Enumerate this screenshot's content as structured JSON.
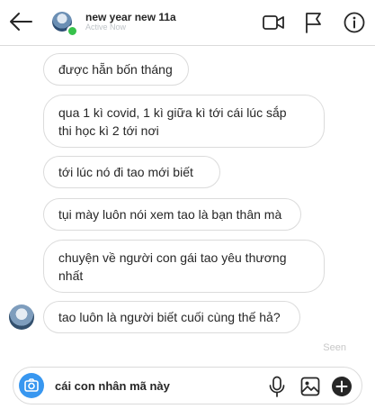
{
  "header": {
    "contact_name": "new year new 11a",
    "status": "Active Now",
    "online_color": "#37c24b",
    "icons": [
      "back-arrow-icon",
      "video-call-icon",
      "report-flag-icon",
      "info-icon"
    ]
  },
  "messages": [
    {
      "text": "được hẵn bốn tháng"
    },
    {
      "line1": "qua 1 kì covid, 1 kì giữa kì tới cái lúc sắp",
      "line2": "thi học kì 2 tới nơi"
    },
    {
      "text": "tới lúc nó đi tao mới biết"
    },
    {
      "text": "tụi mày luôn nói xem tao là bạn thân mà"
    },
    {
      "line1": "chuyện về người con gái tao yêu thương",
      "line2": "nhất"
    },
    {
      "text": "tao luôn là người biết cuối cùng thế hả?"
    }
  ],
  "seen_label": "Seen",
  "composer": {
    "value": "cái con nhân mã này",
    "accent_color": "#3897f0",
    "icons": [
      "camera-icon",
      "microphone-icon",
      "image-icon",
      "add-icon"
    ]
  }
}
